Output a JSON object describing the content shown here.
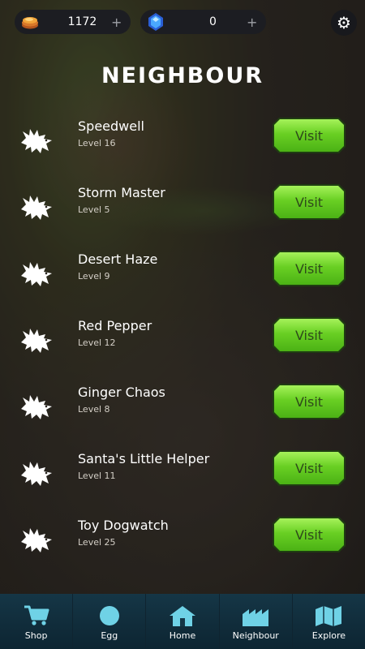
{
  "currency": {
    "coins": {
      "value": "1172",
      "plus": "+",
      "icon": "gold-coins-icon"
    },
    "gems": {
      "value": "0",
      "plus": "+",
      "icon": "blue-gem-icon"
    }
  },
  "settings_icon": "gear-icon",
  "title": "NEIGHBOUR",
  "neighbours": [
    {
      "name": "Speedwell",
      "level": "Level 16",
      "button": "Visit"
    },
    {
      "name": "Storm Master",
      "level": "Level 5",
      "button": "Visit"
    },
    {
      "name": "Desert Haze",
      "level": "Level 9",
      "button": "Visit"
    },
    {
      "name": "Red Pepper",
      "level": "Level 12",
      "button": "Visit"
    },
    {
      "name": "Ginger Chaos",
      "level": "Level 8",
      "button": "Visit"
    },
    {
      "name": "Santa's Little Helper",
      "level": "Level 11",
      "button": "Visit"
    },
    {
      "name": "Toy Dogwatch",
      "level": "Level 25",
      "button": "Visit"
    }
  ],
  "nav": [
    {
      "label": "Shop",
      "icon": "cart-icon"
    },
    {
      "label": "Egg",
      "icon": "egg-icon"
    },
    {
      "label": "Home",
      "icon": "home-icon"
    },
    {
      "label": "Neighbour",
      "icon": "neighbour-factory-icon"
    },
    {
      "label": "Explore",
      "icon": "map-icon"
    }
  ],
  "colors": {
    "visit_button": "#69cf23",
    "nav_icon": "#6fd2e6",
    "top_pill": "#1c1d22"
  }
}
